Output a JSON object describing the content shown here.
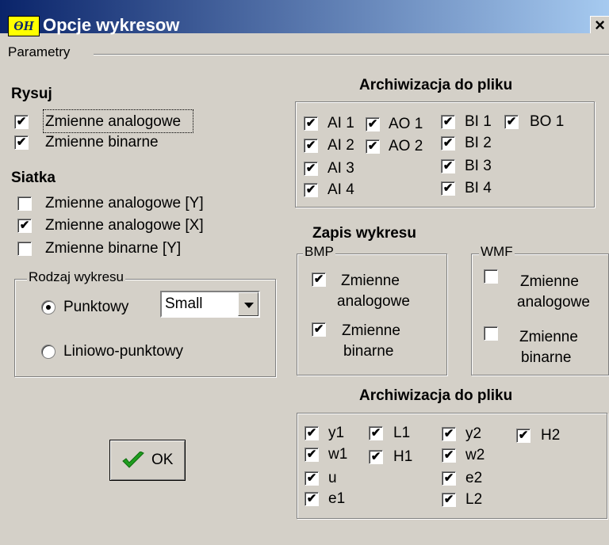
{
  "window": {
    "title": "Opcje wykresow",
    "icon_text": "ӨH",
    "close_label": "×"
  },
  "params_label": "Parametry",
  "rysuj": {
    "heading": "Rysuj",
    "items": [
      {
        "label": "Zmienne analogowe",
        "checked": true
      },
      {
        "label": "Zmienne binarne",
        "checked": true
      }
    ]
  },
  "siatka": {
    "heading": "Siatka",
    "items": [
      {
        "label": "Zmienne analogowe [Y]",
        "checked": false
      },
      {
        "label": "Zmienne analogowe [X]",
        "checked": true
      },
      {
        "label": "Zmienne binarne [Y]",
        "checked": false
      }
    ]
  },
  "rodzaj": {
    "legend": "Rodzaj wykresu",
    "options": [
      {
        "label": "Punktowy",
        "selected": true
      },
      {
        "label": "Liniowo-punktowy",
        "selected": false
      }
    ],
    "combo_value": "Small"
  },
  "archiwizacja1": {
    "heading": "Archiwizacja do pliku",
    "items": [
      {
        "label": "AI 1",
        "checked": true
      },
      {
        "label": "AO 1",
        "checked": true
      },
      {
        "label": "BI 1",
        "checked": true
      },
      {
        "label": "BO 1",
        "checked": true
      },
      {
        "label": "AI 2",
        "checked": true
      },
      {
        "label": "AO 2",
        "checked": true
      },
      {
        "label": "BI 2",
        "checked": true
      },
      {
        "label": "AI 3",
        "checked": true
      },
      {
        "label": "BI 3",
        "checked": true
      },
      {
        "label": "AI 4",
        "checked": true
      },
      {
        "label": "BI 4",
        "checked": true
      }
    ]
  },
  "zapis": {
    "heading": "Zapis wykresu",
    "bmp": {
      "legend": "BMP",
      "items": [
        {
          "line1": "Zmienne",
          "line2": "analogowe",
          "checked": true
        },
        {
          "line1": "Zmienne",
          "line2": "binarne",
          "checked": true
        }
      ]
    },
    "wmf": {
      "legend": "WMF",
      "items": [
        {
          "line1": "Zmienne",
          "line2": "analogowe",
          "checked": false
        },
        {
          "line1": "Zmienne",
          "line2": "binarne",
          "checked": false
        }
      ]
    }
  },
  "archiwizacja2": {
    "heading": "Archiwizacja do pliku",
    "items": [
      {
        "label": "y1",
        "checked": true
      },
      {
        "label": "L1",
        "checked": true
      },
      {
        "label": "y2",
        "checked": true
      },
      {
        "label": "H2",
        "checked": true
      },
      {
        "label": "w1",
        "checked": true
      },
      {
        "label": "H1",
        "checked": true
      },
      {
        "label": "w2",
        "checked": true
      },
      {
        "label": "u",
        "checked": true
      },
      {
        "label": "e2",
        "checked": true
      },
      {
        "label": "e1",
        "checked": true
      },
      {
        "label": "L2",
        "checked": true
      }
    ]
  },
  "ok_button": {
    "label": "OK"
  },
  "colors": {
    "face": "#d4d0c8",
    "title_start": "#0a246a",
    "title_end": "#a6caf0",
    "check_green": "#1f9d1f"
  }
}
